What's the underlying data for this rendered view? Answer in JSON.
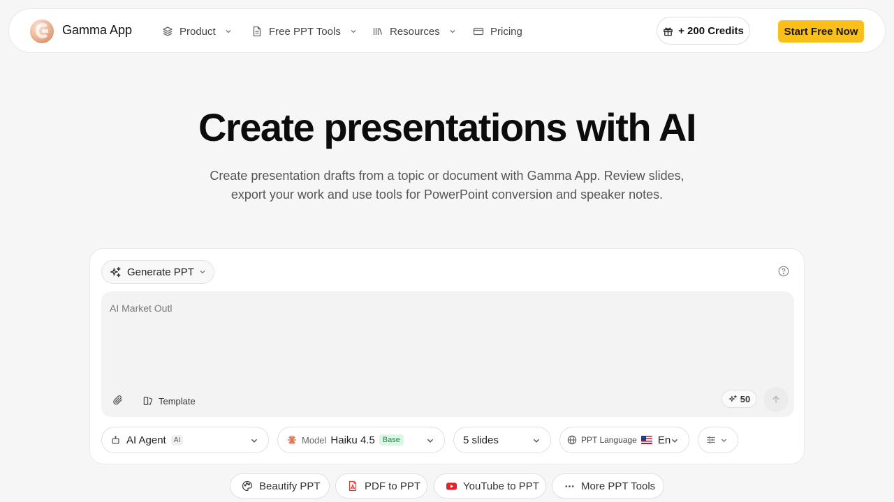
{
  "header": {
    "brand": "Gamma App",
    "nav": [
      {
        "label": "Product",
        "icon": "layers-icon",
        "has_dropdown": true
      },
      {
        "label": "Free PPT Tools",
        "icon": "document-icon",
        "has_dropdown": true
      },
      {
        "label": "Resources",
        "icon": "library-icon",
        "has_dropdown": true
      },
      {
        "label": "Pricing",
        "icon": "credit-card-icon",
        "has_dropdown": false
      }
    ],
    "credits_label": "+ 200 Credits",
    "cta_label": "Start Free Now"
  },
  "hero": {
    "title": "Create presentations with AI",
    "subtitle": "Create presentation drafts from a topic or document with Gamma App. Review slides, export your work and use tools for PowerPoint conversion and speaker notes."
  },
  "generator": {
    "mode_label": "Generate PPT",
    "prompt_value": "AI Market Outl",
    "template_label": "Template",
    "credit_cost": "50",
    "agent": {
      "label": "AI Agent",
      "tag": "AI"
    },
    "model": {
      "label": "Model",
      "value": "Haiku 4.5",
      "tag": "Base"
    },
    "slides": {
      "value": "5 slides"
    },
    "language": {
      "label": "PPT Language",
      "value": "En"
    }
  },
  "tools": [
    {
      "label": "Beautify PPT",
      "icon": "palette-icon"
    },
    {
      "label": "PDF to PPT",
      "icon": "pdf-icon"
    },
    {
      "label": "YouTube to PPT",
      "icon": "youtube-icon"
    },
    {
      "label": "More PPT Tools",
      "icon": "more-icon"
    }
  ],
  "colors": {
    "background": "#f6f6f6",
    "accent": "#fbbf1a",
    "base_tag": "#1e8a4a",
    "youtube": "#e8202a"
  }
}
